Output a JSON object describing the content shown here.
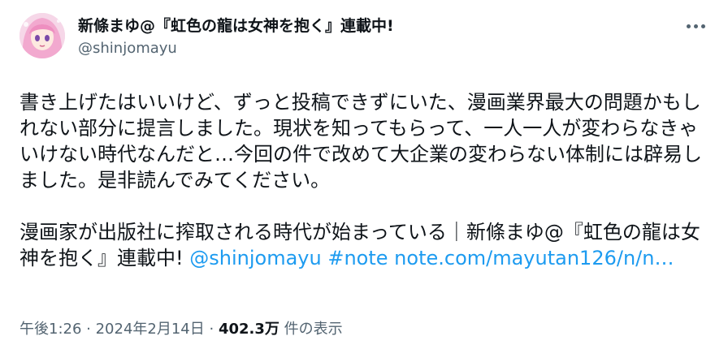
{
  "user": {
    "display_name": "新條まゆ@『虹色の龍は女神を抱く』連載中!",
    "handle": "@shinjomayu",
    "avatar_icon": "user-avatar-illustration"
  },
  "more_icon": "more-dots-icon",
  "tweet": {
    "paragraph1": "書き上げたはいいけど、ずっと投稿できずにいた、漫画業界最大の問題かもしれない部分に提言しました。現状を知ってもらって、一人一人が変わらなきゃいけない時代なんだと…今回の件で改めて大企業の変わらない体制には辟易しました。是非読んでみてください。",
    "paragraph2_text": "漫画家が出版社に搾取される時代が始まっている｜新條まゆ@『虹色の龍は女神を抱く』連載中! ",
    "mention": "@shinjomayu",
    "hashtag": "#note",
    "url": "note.com/mayutan126/n/n…"
  },
  "meta": {
    "time": "午後1:26",
    "sep1": " · ",
    "date": "2024年2月14日",
    "sep2": " · ",
    "views": "402.3万",
    "views_label": " 件の表示"
  },
  "colors": {
    "text": "#0f1419",
    "secondary": "#536471",
    "link": "#1d9bf0"
  }
}
